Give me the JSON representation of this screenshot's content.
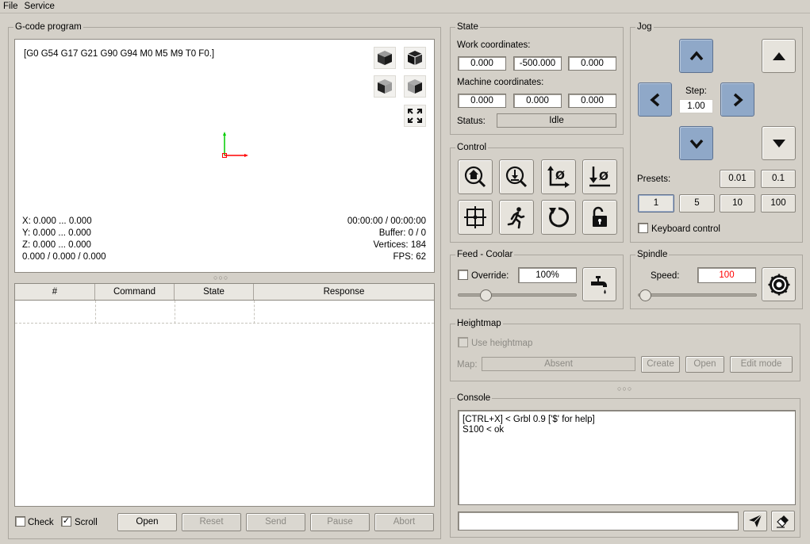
{
  "menu": {
    "file": "File",
    "service": "Service"
  },
  "gcode": {
    "group_title": "G-code program",
    "parser_state": "[G0 G54 G17 G21 G90 G94 M0 M5 M9 T0 F0.]",
    "x_range": "X: 0.000 ... 0.000",
    "y_range": "Y: 0.000 ... 0.000",
    "z_range": "Z: 0.000 ... 0.000",
    "position": "0.000 / 0.000 / 0.000",
    "time": "00:00:00 / 00:00:00",
    "buffer": "Buffer: 0 / 0",
    "vertices": "Vertices: 184",
    "fps": "FPS: 62",
    "table_headers": [
      "#",
      "Command",
      "State",
      "Response"
    ],
    "check_label": "Check",
    "scroll_label": "Scroll",
    "check_checked": false,
    "scroll_checked": true,
    "buttons": {
      "open": "Open",
      "reset": "Reset",
      "send": "Send",
      "pause": "Pause",
      "abort": "Abort"
    }
  },
  "state": {
    "group_title": "State",
    "work_label": "Work coordinates:",
    "work": [
      "0.000",
      "-500.000",
      "0.000"
    ],
    "machine_label": "Machine coordinates:",
    "machine": [
      "0.000",
      "0.000",
      "0.000"
    ],
    "status_label": "Status:",
    "status": "Idle"
  },
  "control": {
    "group_title": "Control"
  },
  "jog": {
    "group_title": "Jog",
    "step_label": "Step:",
    "step_value": "1.00",
    "presets_label": "Presets:",
    "presets_top": [
      "0.01",
      "0.1"
    ],
    "presets_bottom": [
      "1",
      "5",
      "10",
      "100"
    ],
    "selected_preset": "1",
    "keyboard_label": "Keyboard control",
    "keyboard_checked": false
  },
  "feed": {
    "group_title": "Feed - Coolar",
    "override_label": "Override:",
    "override_value": "100%",
    "override_checked": false,
    "slider_level": 0.1
  },
  "spindle": {
    "group_title": "Spindle",
    "speed_label": "Speed:",
    "speed_value": "100",
    "speed_color": "#ff0000",
    "slider_level": 0.05
  },
  "heightmap": {
    "group_title": "Heightmap",
    "use_label": "Use heightmap",
    "map_label": "Map:",
    "map_value": "Absent",
    "create": "Create",
    "open": "Open",
    "edit": "Edit mode"
  },
  "console": {
    "group_title": "Console",
    "lines": [
      "[CTRL+X] < Grbl 0.9 ['$' for help]",
      "S100 < ok"
    ],
    "input_value": ""
  },
  "colors": {
    "jog_blue": "#8fa8c8",
    "axis_x": "#ff0000",
    "axis_y": "#00cc00"
  }
}
